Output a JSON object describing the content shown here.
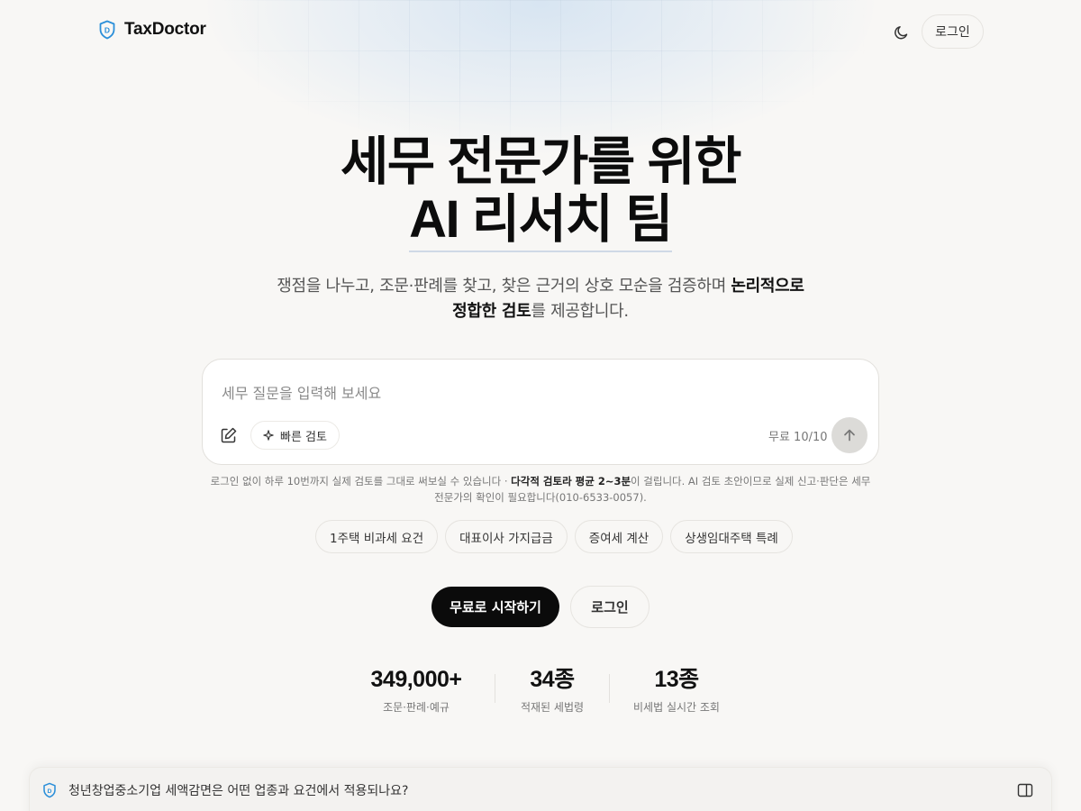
{
  "header": {
    "brand": "TaxDoctor",
    "login_label": "로그인"
  },
  "hero": {
    "title_line1": "세무 전문가를 위한",
    "title_line2": "AI 리서치 팀",
    "subtitle_plain": "쟁점을 나누고, 조문·판례를 찾고, 찾은 근거의 상호 모순을 검증하며 ",
    "subtitle_bold": "논리적으로 정합한 검토",
    "subtitle_end": "를 제공합니다."
  },
  "composer": {
    "placeholder": "세무 질문을 입력해 보세요",
    "quick_review_label": "빠른 검토",
    "usage": "무료 10/10"
  },
  "notice": {
    "part1": "로그인 없이 하루 10번까지 실제 검토를 그대로 써보실 수 있습니다 · ",
    "bold": "다각적 검토라 평균 2~3분",
    "part2": "이 걸립니다. AI 검토 초안이므로 실제 신고·판단은 세무 전문가의 확인이 필요합니다(010-6533-0057)."
  },
  "suggestions": [
    "1주택 비과세 요건",
    "대표이사 가지급금",
    "증여세 계산",
    "상생임대주택 특례"
  ],
  "cta": {
    "primary": "무료로 시작하기",
    "secondary": "로그인"
  },
  "stats": [
    {
      "value": "349,000+",
      "label": "조문·판례·예규"
    },
    {
      "value": "34종",
      "label": "적재된 세법령"
    },
    {
      "value": "13종",
      "label": "비세법 실시간 조회"
    }
  ],
  "preview": {
    "question": "청년창업중소기업 세액감면은 어떤 업종과 요건에서 적용되나요?"
  },
  "colors": {
    "accent": "#2b8fd9",
    "primary_button": "#0b0b0b",
    "background": "#f8f7f5"
  }
}
